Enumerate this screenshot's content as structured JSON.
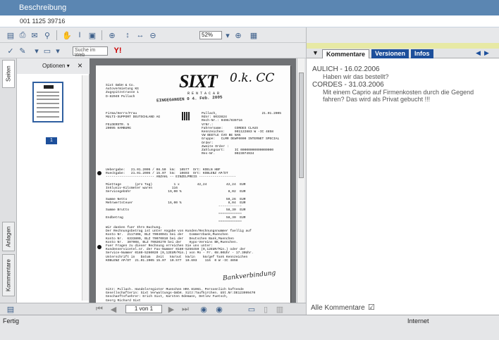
{
  "header": {
    "title": "Beschreibung",
    "doc_number": "001 1125 39716"
  },
  "toolbar": {
    "zoom": "52%",
    "search_placeholder": "Suche im Web"
  },
  "side_tabs": [
    "Seiten",
    "Anlagen",
    "Kommentare"
  ],
  "thumb_panel": {
    "options_label": "Optionen ▾",
    "close": "×",
    "page_number": "1"
  },
  "navigation": {
    "page_indicator": "1 von 1"
  },
  "document": {
    "logo": "SIXT",
    "logo_sub": "R E N T A C A R",
    "stamp": "EINGEGANGEN 0 4. Feb. 2005",
    "handwriting": "0.k. CC",
    "handwriting_2": "Bankverbindung",
    "sender": "Sixt GmbH & Co.\nAutovermietung KG\nZugspitzstrasse 1\nD-82049 Pullach",
    "recipient": "Firma/Herrn/Frau\nMULTI-SUPPORT DEUTSCHLAND AG\n\nFELDERSTR. 5\n20095 HAMBURG",
    "info": "Pullach,                       21.01.2005\nRdnr: 6033824\nRech-Nr.: 0496/039716\nVrNr.:\nFahrername:      CORDES CLAUS\nKennzeichen:     001122883 W -IC 4858\nVW BEETLE CVO BE NAN\nGruppe:   CLMR DEWF0000 INTERNET SPECIAL\nOrder:\nZweite Order :\nZahlungsart:     IC 00000000000000000\nRes-Nr.          0023074934",
    "line_items": "Uebergabe:   21.01.2005 / 08.50  km:  10577  Ort: KOELN HBF\nRueckgabe:   21.01.2005 / 15.07  km:  10693  Ort: KOBLENZ AP/DT\n------------------------- ANZAHL -- EINZELPREIS -------------------\n\nMiettage       (pro Tag)           1 x         42,24          42,24  EUR\nInklusiv-Kilometer waren          116\nServicegebühr                   19,00 %                        8,02  EUR\n\nSumme Netto                                                   50,26  EUR\nMehrwertsteuer                  16,00 %                        8,04  EUR\n                                                          ------------\nSumme Brutto                                                  58,30  EUR\n                                                          ============\nEndbetrag                                                     58,30  EUR\n                                                          ============",
    "footer_text": "Wir danken fuer Ihre Buchung.\nDer Rechnungsbetrag ist unter Angabe von Kunden/Rechnungsnummer faellig auf\nKonto Nr.  2117408, BLZ 70040041 bei der   Commerzbank,Muenchen\nKonto Nr.  6333800, BLZ 70070010 bei der   Deutschen Bank,Muenchen\nKonto Nr.  307008, BLZ 70020270 bei der    Hypo-Vereins BK,Muenchen.\nFuer Fragen zu dieser Rechnung erreichen Sie uns unter:\nKundenservicetel.nr. der Fax-Nummer 0180-5256450 (0,12EUR/Min.) oder der\nService-Nummer 0180-5260020 (0,12EUR/Min.) von Mo - Fr. 08.00Uhr - 17.30Uhr.\nUnterschrift in   Datum   Zeit   km/out  km/in    km/gef Tank Kennzeichen\nKOBLENZ AP/DT  21.01.2005 15.07  10.577  10.693    116  0 W -IC 4858",
    "bottom_text": "Sitz: Pullach. Handelsregister Muenchen HRA 81061. Persoenlich haftende\nGesellschafterin: Sixt Verwaltungs-GmbH. Sitz:Taufkirchen. USt.Nr:DE123999470\nGeschaeftsfuehrer: Erich Sixt, Karsten Odemann, Detlev Fuetsch,\nGeorg Richard Sixt"
  },
  "comments_panel": {
    "tabs": [
      "Kommentare",
      "Versionen",
      "Infos"
    ],
    "entries": [
      {
        "header": "AULICH - 16.02.2006",
        "text": "Haben wir das bestellt?"
      },
      {
        "header": "CORDES - 31.03.2006",
        "text": "Mit einem Caprio auf Firmenkosten durch die Gegend fahren? Das wird als Privat gebucht !!!"
      }
    ],
    "all_comments_label": "Alle Kommentare",
    "all_comments_checked": "☑"
  },
  "statusbar": {
    "left": "Fertig",
    "zone": "Internet"
  }
}
